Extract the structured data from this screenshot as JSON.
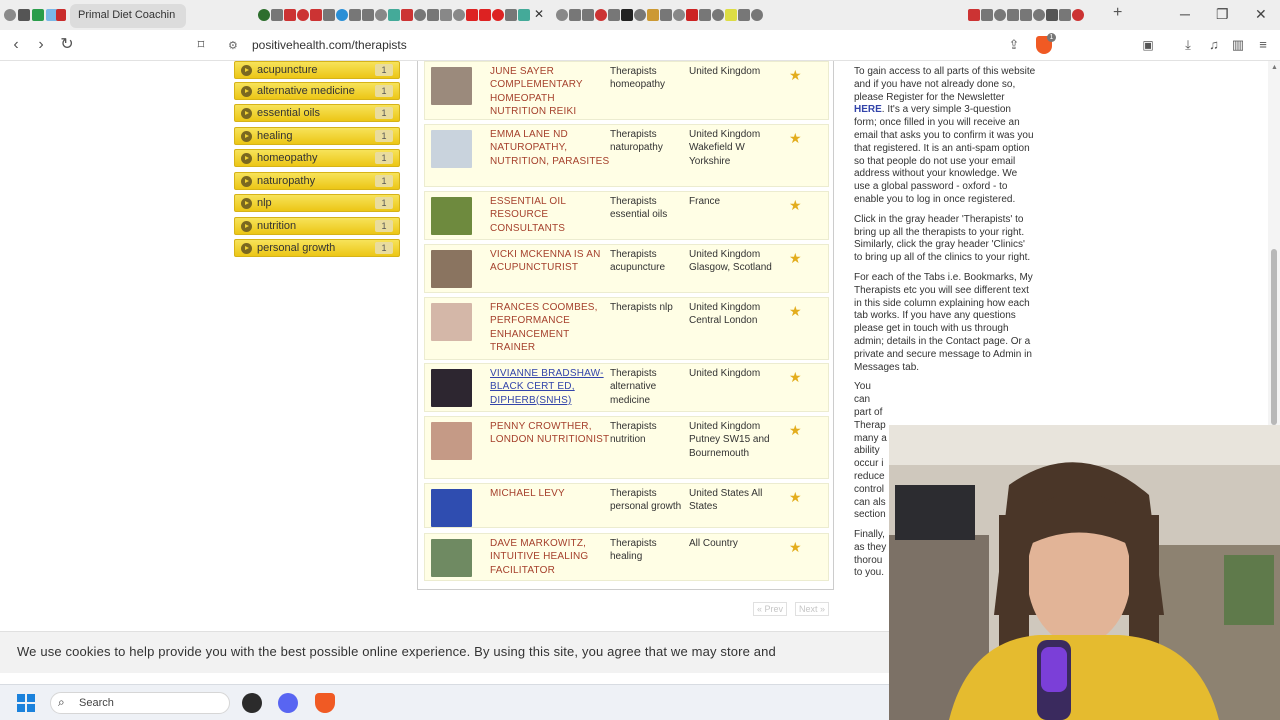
{
  "browser": {
    "active_tab_title": "Primal Diet Coachin",
    "url": "positivehealth.com/therapists",
    "shields_count": "1"
  },
  "tags": [
    {
      "label": "acupuncture",
      "count": "1"
    },
    {
      "label": "alternative medicine",
      "count": "1"
    },
    {
      "label": "essential oils",
      "count": "1"
    },
    {
      "label": "healing",
      "count": "1"
    },
    {
      "label": "homeopathy",
      "count": "1"
    },
    {
      "label": "naturopathy",
      "count": "1"
    },
    {
      "label": "nlp",
      "count": "1"
    },
    {
      "label": "nutrition",
      "count": "1"
    },
    {
      "label": "personal growth",
      "count": "1"
    }
  ],
  "therapists": [
    {
      "name": "JUNE SAYER COMPLEMENTARY HOMEOPATH NUTRITION REIKI",
      "category": "Therapists homeopathy",
      "location": "United Kingdom",
      "photo_color": "#9b8a7c"
    },
    {
      "name": "EMMA LANE ND NATUROPATHY, NUTRITION, PARASITES",
      "category": "Therapists naturopathy",
      "location": "United Kingdom Wakefield W Yorkshire",
      "photo_color": "#c9d3dd"
    },
    {
      "name": "ESSENTIAL OIL RESOURCE CONSULTANTS",
      "category": "Therapists essential oils",
      "location": "France",
      "photo_color": "#6e8a3e"
    },
    {
      "name": "VICKI MCKENNA IS AN ACUPUNCTURIST",
      "category": "Therapists acupuncture",
      "location": "United Kingdom Glasgow, Scotland",
      "photo_color": "#8a7460"
    },
    {
      "name": "FRANCES COOMBES, PERFORMANCE ENHANCEMENT TRAINER",
      "category": "Therapists nlp",
      "location": "United Kingdom Central London",
      "photo_color": "#d4b7a8"
    },
    {
      "name": "VIVIANNE BRADSHAW-BLACK CERT ED, DIPHERB(SNHS)",
      "category": "Therapists alternative medicine",
      "location": "United Kingdom",
      "photo_color": "#2d2630"
    },
    {
      "name": "PENNY CROWTHER, LONDON NUTRITIONIST",
      "category": "Therapists nutrition",
      "location": "United Kingdom Putney SW15 and Bournemouth",
      "photo_color": "#c59a86"
    },
    {
      "name": "MICHAEL LEVY",
      "category": "Therapists personal growth",
      "location": "United States All States",
      "photo_color": "#2f4db0"
    },
    {
      "name": "DAVE MARKOWITZ, INTUITIVE HEALING FACILITATOR",
      "category": "Therapists healing",
      "location": "All Country",
      "photo_color": "#6f8a62"
    }
  ],
  "pager": {
    "prev": "« Prev",
    "next": "Next »"
  },
  "side_text": {
    "p1_before": "To gain access to all parts of this website and if you have not already done so, please Register for the Newsletter",
    "p1_link": "HERE",
    "p1_after": ". It's a very simple 3-question form; once filled in you will receive an email that asks you to confirm it was you that registered. It is an anti-spam option so that people do not use your email address without your knowledge. We use a global password - oxford - to enable you to log in once registered.",
    "p2": "Click in the gray header 'Therapists' to bring up all the therapists to your right. Similarly, click the gray header 'Clinics' to bring up all of the clinics to your right.",
    "p3": "For each of the Tabs i.e. Bookmarks, My Therapists etc you will see different text in this side column explaining how each tab works. If you have any questions please get in touch with us through admin; details in the Contact page. Or a private and secure message to Admin in Messages tab.",
    "p4": "You can part of Therap many a ability occur i reduce control can als section",
    "p5": "Finally, as they thorou to you."
  },
  "cookie_text": "We use cookies to help provide you with the best possible online experience. By using this site, you agree that we may store and",
  "taskbar": {
    "search_placeholder": "Search"
  }
}
